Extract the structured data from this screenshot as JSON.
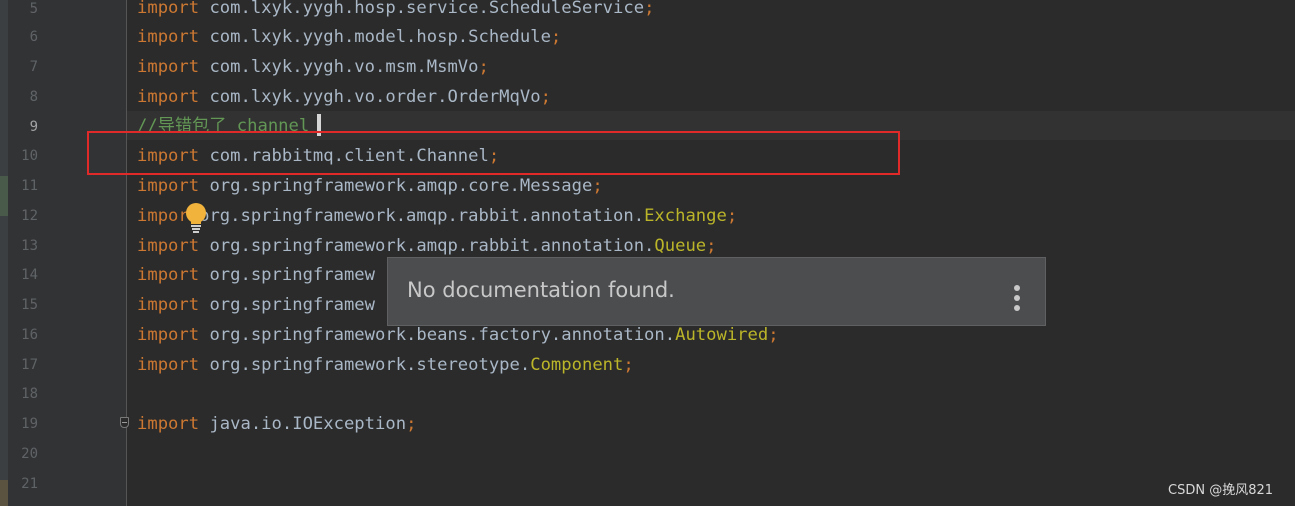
{
  "editor": {
    "line_numbers": [
      "5",
      "6",
      "7",
      "8",
      "9",
      "10",
      "11",
      "12",
      "13",
      "14",
      "15",
      "16",
      "17",
      "18",
      "19",
      "20",
      "21"
    ],
    "current_line": "9",
    "left_strip_glyph": "do",
    "lines": {
      "l5": {
        "kw": "import",
        "path": " com.lxyk.yygh.hosp.service.ScheduleService",
        "semi": ";"
      },
      "l6": {
        "kw": "import",
        "path": " com.lxyk.yygh.model.hosp.Schedule",
        "semi": ";"
      },
      "l7": {
        "kw": "import",
        "path": " com.lxyk.yygh.vo.msm.MsmVo",
        "semi": ";"
      },
      "l8": {
        "kw": "import",
        "path": " com.lxyk.yygh.vo.order.OrderMqVo",
        "semi": ";"
      },
      "l9": {
        "comment": "//导错包了 channel"
      },
      "l10": {
        "kw": "import",
        "path": " com.rabbitmq.client.Channel",
        "semi": ";"
      },
      "l11": {
        "kw": "import",
        "path": " org.springframework.amqp.core.Message",
        "semi": ";"
      },
      "l12": {
        "kw": "impor",
        "path": " org.springframework.amqp.rabbit.annotation.",
        "ann": "Exchange",
        "semi": ";"
      },
      "l13": {
        "kw": "import",
        "path": " org.springframework.amqp.rabbit.annotation.",
        "ann": "Queue",
        "semi": ";"
      },
      "l14": {
        "kw": "import",
        "path": " org.springframew"
      },
      "l15": {
        "kw": "import",
        "path": " org.springframew"
      },
      "l16": {
        "kw": "import",
        "path": " org.springframework.beans.factory.annotation.",
        "ann": "Autowired",
        "semi": ";"
      },
      "l17": {
        "kw": "import",
        "path": " org.springframework.stereotype.",
        "ann": "Component",
        "semi": ";"
      },
      "l19": {
        "kw": "import",
        "path": " java.io.IOException",
        "semi": ";"
      }
    }
  },
  "doc_popup": {
    "message": "No documentation found.",
    "more_icon": "vertical-ellipsis-icon"
  },
  "intention_icon": "lightbulb-icon",
  "watermark": "CSDN @挽风821",
  "colors": {
    "background": "#2b2b2b",
    "keyword": "#cc7832",
    "annotation": "#bbb529",
    "comment": "#629755",
    "text": "#a9b7c6",
    "highlight_box": "#e02a2a",
    "lightbulb": "#f2b33d"
  }
}
